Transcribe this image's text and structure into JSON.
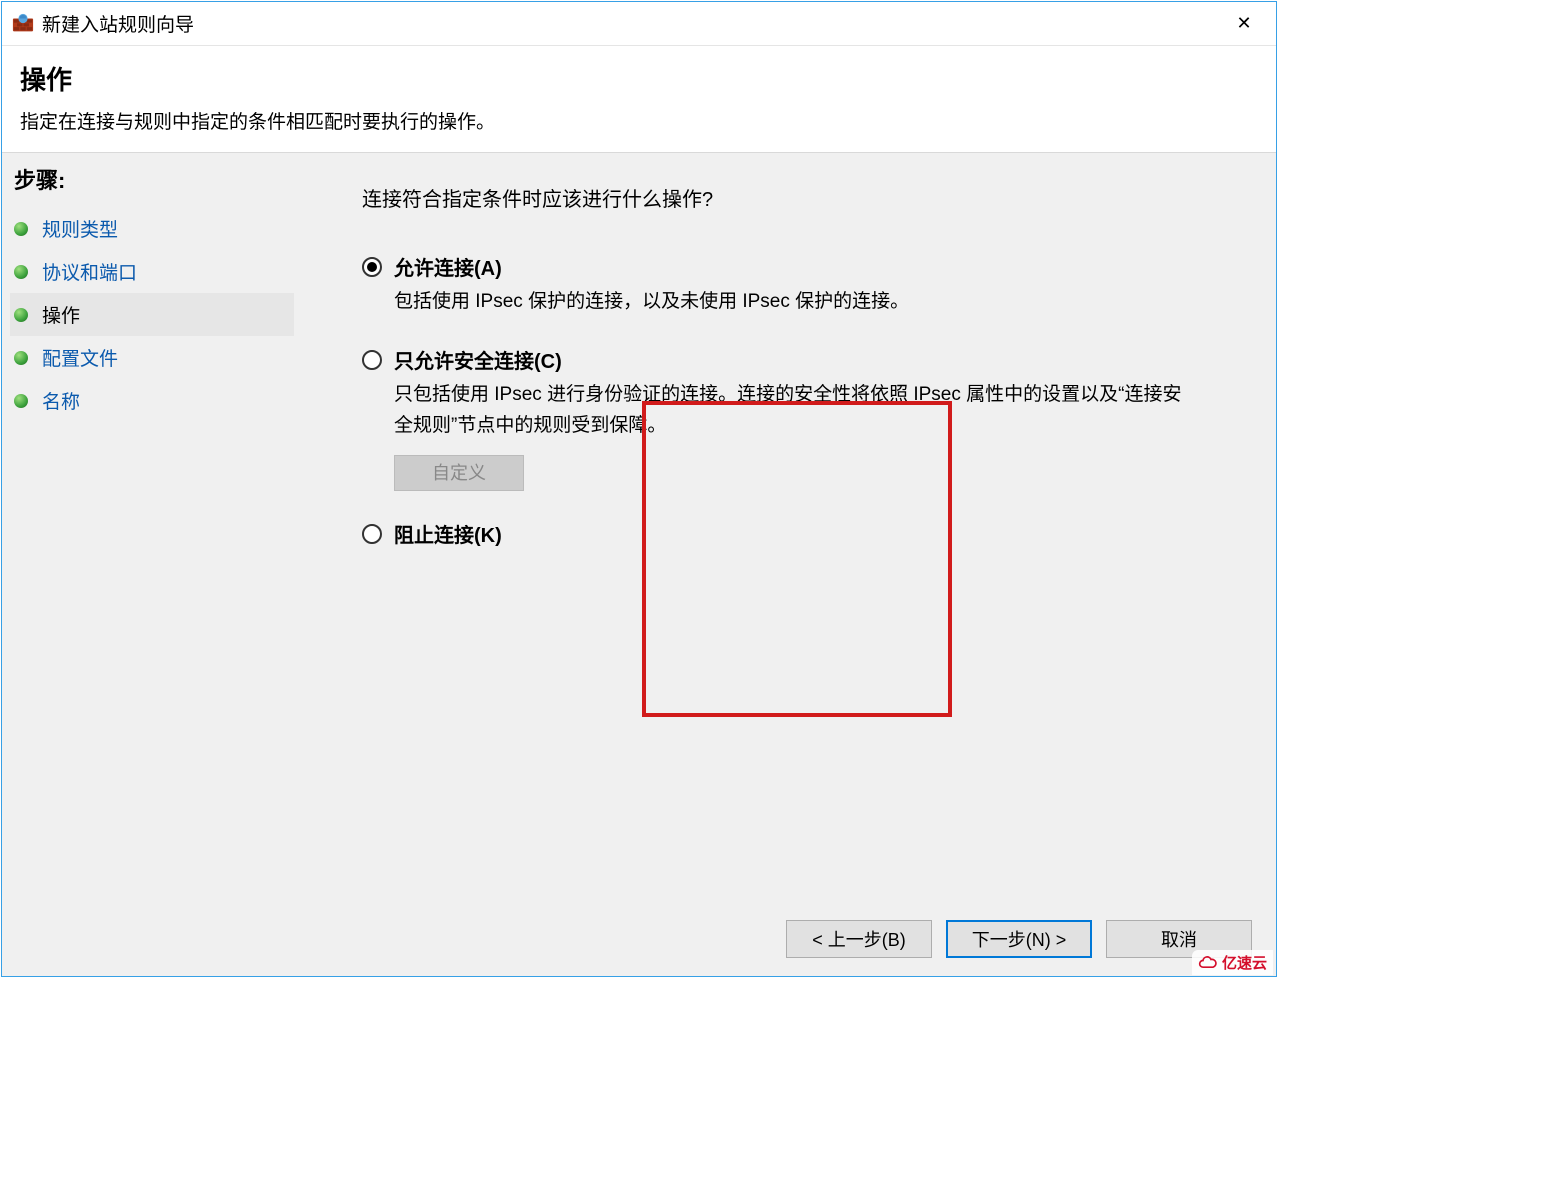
{
  "titlebar": {
    "title": "新建入站规则向导",
    "close_glyph": "✕"
  },
  "header": {
    "title": "操作",
    "subtitle": "指定在连接与规则中指定的条件相匹配时要执行的操作。"
  },
  "sidebar": {
    "steps_label": "步骤:",
    "items": [
      {
        "label": "规则类型",
        "active": false
      },
      {
        "label": "协议和端口",
        "active": false
      },
      {
        "label": "操作",
        "active": true
      },
      {
        "label": "配置文件",
        "active": false
      },
      {
        "label": "名称",
        "active": false
      }
    ]
  },
  "content": {
    "question": "连接符合指定条件时应该进行什么操作?",
    "options": [
      {
        "key": "allow",
        "selected": true,
        "label": "允许连接(A)",
        "desc": "包括使用 IPsec 保护的连接，以及未使用 IPsec 保护的连接。"
      },
      {
        "key": "secure",
        "selected": false,
        "label": "只允许安全连接(C)",
        "desc": "只包括使用 IPsec 进行身份验证的连接。连接的安全性将依照 IPsec 属性中的设置以及“连接安全规则”节点中的规则受到保障。",
        "custom_button": "自定义"
      },
      {
        "key": "block",
        "selected": false,
        "label": "阻止连接(K)",
        "desc": ""
      }
    ]
  },
  "footer": {
    "back": "< 上一步(B)",
    "next": "下一步(N) >",
    "cancel": "取消"
  },
  "watermark": "亿速云"
}
